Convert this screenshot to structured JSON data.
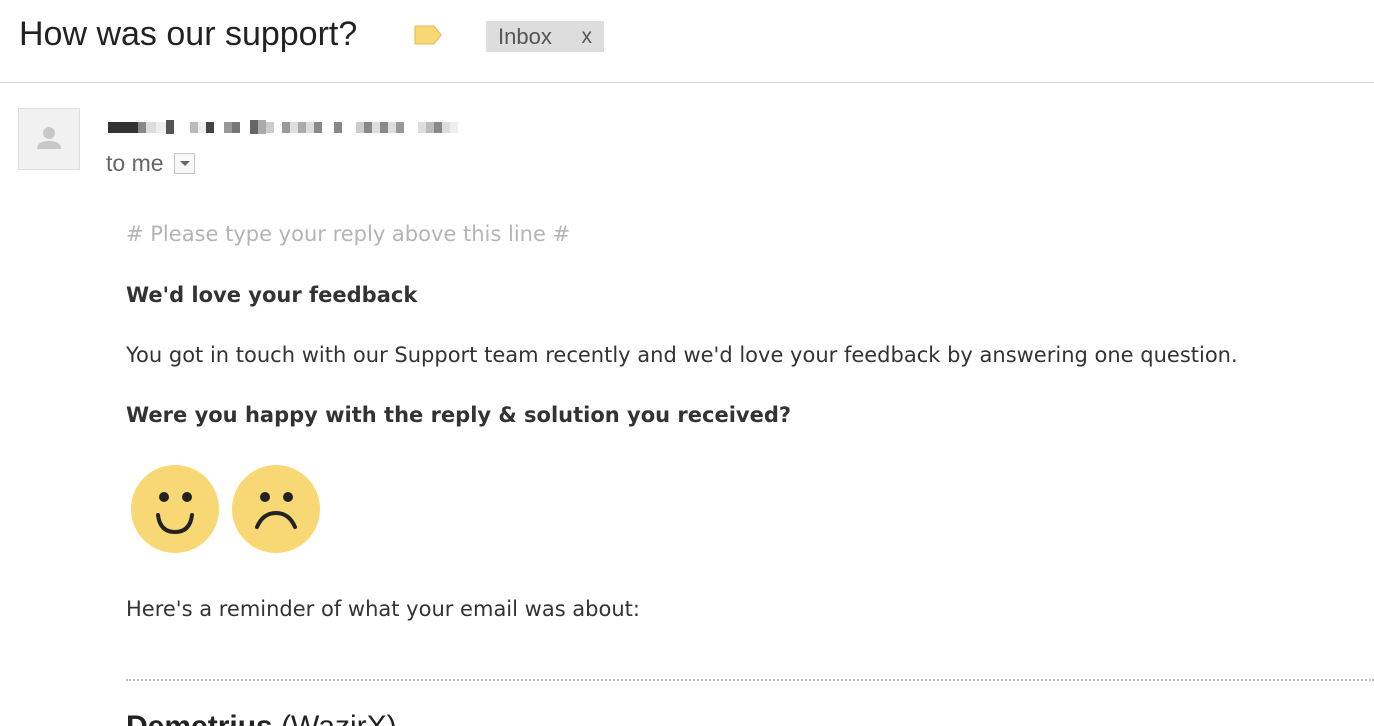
{
  "email": {
    "subject": "How was our support?",
    "label_icon": "label-tag-icon",
    "label_color": "#f8d775",
    "inbox_chip": {
      "label": "Inbox",
      "remove": "x"
    },
    "sender": {
      "avatar_icon": "person-icon",
      "redacted": true,
      "recipient_text": "to me"
    },
    "body": {
      "reply_line": "# Please type your reply above this line #",
      "feedback_heading": "We'd love your feedback",
      "intro": "You got in touch with our Support team recently and we'd love your feedback by answering one question.",
      "question": "Were you happy with the reply & solution you received?",
      "ratings": [
        {
          "icon": "happy-face-icon",
          "meaning": "happy"
        },
        {
          "icon": "sad-face-icon",
          "meaning": "unhappy"
        }
      ],
      "face_color": "#f8d775",
      "reminder": "Here's a reminder of what your email was about:",
      "agent_name": "Demetrius",
      "agent_org": "(WazirX)"
    }
  }
}
